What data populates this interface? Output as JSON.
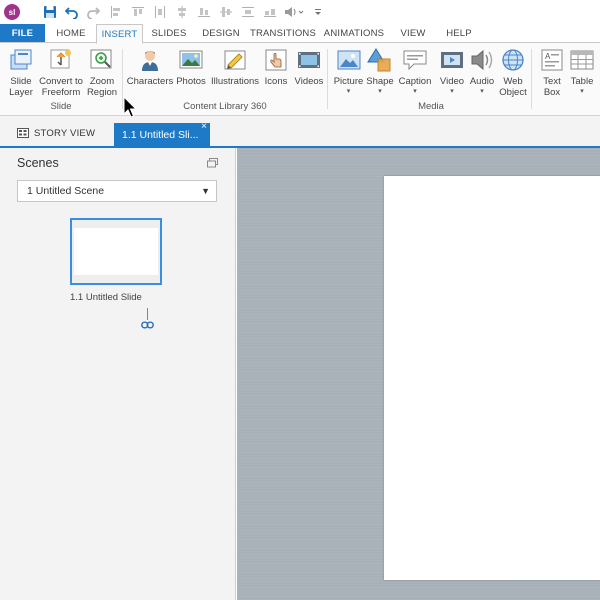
{
  "app": {
    "logo_text": "sl"
  },
  "quick_access": {
    "icons": [
      "save-icon",
      "undo-icon",
      "redo-icon",
      "align-left-icon",
      "align-top-icon",
      "distribute-icon",
      "align-center-icon",
      "align-bottom-icon",
      "align-middle-icon",
      "distribute-vertical-icon",
      "volume-icon",
      "customize-icon"
    ]
  },
  "ribbon_tabs": [
    {
      "label": "FILE"
    },
    {
      "label": "HOME"
    },
    {
      "label": "INSERT"
    },
    {
      "label": "SLIDES"
    },
    {
      "label": "DESIGN"
    },
    {
      "label": "TRANSITIONS"
    },
    {
      "label": "ANIMATIONS"
    },
    {
      "label": "VIEW"
    },
    {
      "label": "HELP"
    }
  ],
  "active_tab": "INSERT",
  "ribbon": {
    "slide_group": {
      "label": "Slide",
      "slide_layer": [
        "Slide",
        "Layer"
      ],
      "convert_freeform": [
        "Convert to",
        "Freeform"
      ],
      "zoom_region": [
        "Zoom",
        "Region"
      ]
    },
    "content_library_group": {
      "label": "Content Library 360",
      "characters": "Characters",
      "photos": "Photos",
      "illustrations": "Illustrations",
      "icons": "Icons",
      "videos": "Videos"
    },
    "media_group": {
      "label": "Media",
      "picture": "Picture",
      "shape": "Shape",
      "caption": "Caption",
      "video": "Video",
      "audio": "Audio",
      "web_object": [
        "Web",
        "Object"
      ]
    },
    "text_group": {
      "text_box": [
        "Text",
        "Box"
      ],
      "table": "Table"
    },
    "dropdown_caret": "▾"
  },
  "doc_tabs": {
    "story_view": "STORY VIEW",
    "current_slide": "1.1 Untitled Sli...",
    "close": "×"
  },
  "scenes_panel": {
    "title": "Scenes",
    "scene_selector": "1 Untitled Scene",
    "dropdown_caret": "▼",
    "slides": [
      {
        "label": "1.1 Untitled Slide"
      }
    ]
  },
  "colors": {
    "accent": "#1e7ac6",
    "canvas": "#a8b0b8",
    "panel": "#f3f3f3",
    "logo": "#a0348a"
  }
}
